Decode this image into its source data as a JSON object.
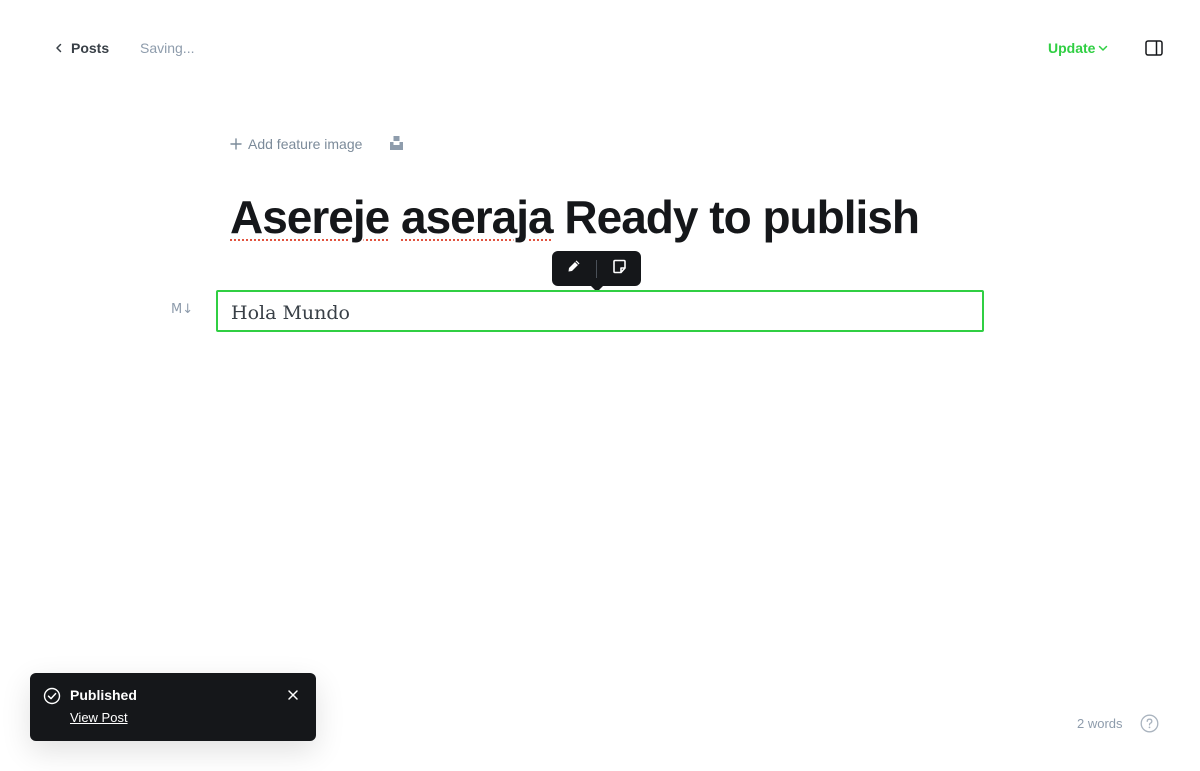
{
  "header": {
    "back_label": "Posts",
    "status": "Saving...",
    "update_label": "Update"
  },
  "editor": {
    "add_feature_image": "Add feature image",
    "title_words": [
      "Asereje",
      "aseraja",
      "Ready to publish"
    ],
    "card_content": "Hola Mundo",
    "markdown_icon_text": "M↓"
  },
  "toast": {
    "title": "Published",
    "link_label": "View Post"
  },
  "footer": {
    "word_count": "2 words"
  },
  "icons": {
    "back": "chevron-left-icon",
    "update_caret": "chevron-down-icon",
    "sidebar": "sidebar-toggle-icon",
    "add": "plus-icon",
    "unsplash": "unsplash-icon",
    "edit": "pencil-icon",
    "snippet": "snippet-icon",
    "markdown": "markdown-icon",
    "toast_status": "check-circle-icon",
    "close": "close-icon",
    "help": "help-icon"
  },
  "colors": {
    "accent": "#30cf43",
    "dark": "#15171a",
    "muted": "#8e9cac",
    "spellcheck": "#e25440"
  }
}
